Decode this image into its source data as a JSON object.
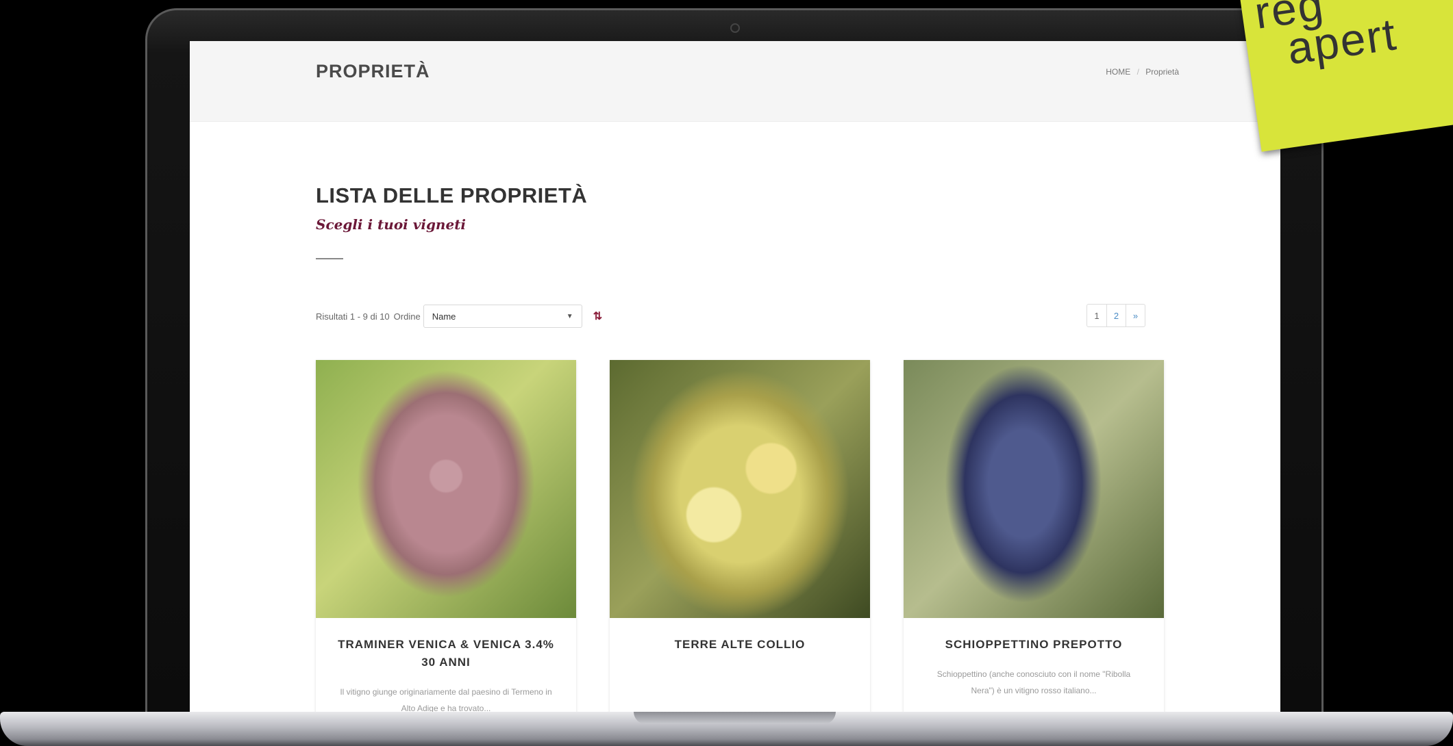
{
  "header": {
    "title": "PROPRIETÀ",
    "breadcrumb": [
      "HOME",
      "Proprietà"
    ]
  },
  "page": {
    "heading": "LISTA DELLE PROPRIETÀ",
    "subheading": "Scegli i tuoi vigneti"
  },
  "toolbar": {
    "results": "Risultati 1 - 9 di 10",
    "order_label": "Ordine",
    "order_value": "Name",
    "sort_icon": "sort-icon"
  },
  "pagination": [
    "1",
    "2",
    "»"
  ],
  "cards": [
    {
      "title": "TRAMINER VENICA & VENICA 3.4% 30 ANNI",
      "desc": "Il vitigno giunge originariamente dal paesino di Termeno in Alto Adige e ha trovato..."
    },
    {
      "title": "TERRE ALTE COLLIO",
      "desc": ""
    },
    {
      "title": "SCHIOPPETTINO PREPOTTO",
      "desc": "Schioppettino (anche conosciuto con il nome \"Ribolla Nera\") è un vitigno rosso italiano..."
    }
  ],
  "sticky_note": {
    "line1": "reg",
    "line2": "apert"
  }
}
